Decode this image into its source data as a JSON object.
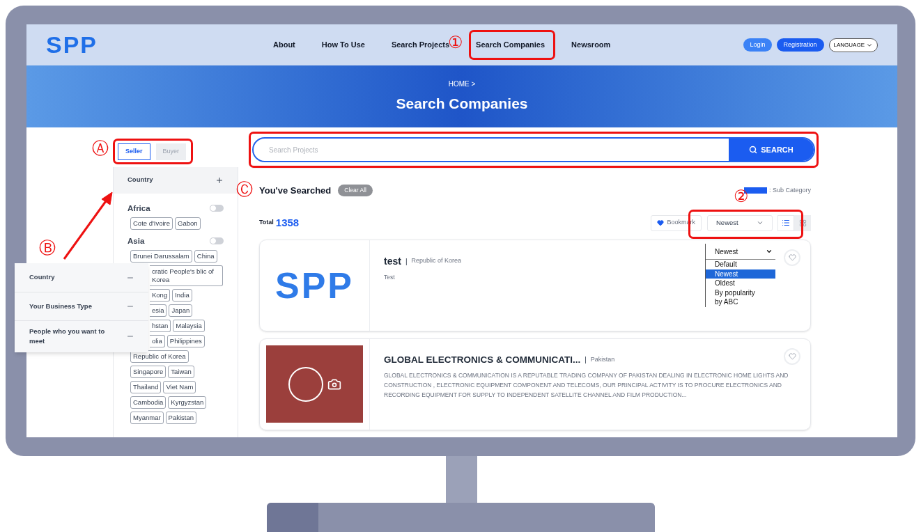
{
  "nav": {
    "logo": "SPP",
    "links": [
      {
        "label": "About"
      },
      {
        "label": "How To Use"
      },
      {
        "label": "Search Projects"
      },
      {
        "label": "Search Companies"
      },
      {
        "label": "Newsroom"
      }
    ],
    "login": "Login",
    "registration": "Registration",
    "language": "LANGUAGE"
  },
  "banner": {
    "breadcrumb": "HOME >",
    "title": "Search Companies"
  },
  "role_tabs": [
    {
      "label": "Seller",
      "selected": true
    },
    {
      "label": "Buyer",
      "selected": false
    }
  ],
  "filter": {
    "header": {
      "label": "Country",
      "expanded": false
    },
    "sections": [
      {
        "name": "Africa",
        "on": false,
        "rows": [
          [
            {
              "label": "Cote d'Ivoire",
              "kind": "full"
            },
            {
              "label": "Gabon",
              "kind": "full"
            }
          ]
        ]
      },
      {
        "name": "Asia",
        "on": false,
        "rows": [
          [
            {
              "label": "Brunei Darussalam",
              "kind": "full"
            },
            {
              "label": "China",
              "kind": "full"
            }
          ],
          [
            {
              "label": "cratic People's blic of Korea",
              "kind": "partial"
            }
          ],
          [
            {
              "label": "Kong",
              "kind": "partial"
            },
            {
              "label": "India",
              "kind": "full"
            }
          ],
          [
            {
              "label": "esia",
              "kind": "partial"
            },
            {
              "label": "Japan",
              "kind": "full"
            }
          ],
          [
            {
              "label": "hstan",
              "kind": "partial"
            },
            {
              "label": "Malaysia",
              "kind": "full"
            }
          ],
          [
            {
              "label": "olia",
              "kind": "partial"
            },
            {
              "label": "Philippines",
              "kind": "full"
            }
          ],
          [
            {
              "label": "Republic of Korea",
              "kind": "full"
            }
          ],
          [
            {
              "label": "Singapore",
              "kind": "full"
            },
            {
              "label": "Taiwan",
              "kind": "full"
            }
          ],
          [
            {
              "label": "Thailand",
              "kind": "full"
            },
            {
              "label": "Viet Nam",
              "kind": "full"
            }
          ],
          [
            {
              "label": "Cambodia",
              "kind": "full"
            },
            {
              "label": "Kyrgyzstan",
              "kind": "full"
            }
          ],
          [
            {
              "label": "Myanmar",
              "kind": "full"
            },
            {
              "label": "Pakistan",
              "kind": "full"
            }
          ]
        ]
      }
    ]
  },
  "filter_popout": [
    {
      "label": "Country",
      "expanded": true
    },
    {
      "label": "Your Business Type",
      "expanded": true
    },
    {
      "label": "People who you want to meet",
      "expanded": true
    }
  ],
  "search": {
    "placeholder": "Search Projects",
    "button": "SEARCH"
  },
  "searched": {
    "title": "You've Searched",
    "clear": "Clear All",
    "legend": ": Sub Category"
  },
  "total": {
    "label": "Total",
    "count": "1358"
  },
  "toolbar": {
    "bookmark": "Bookmark",
    "sort": "Newest",
    "views": [
      {
        "kind": "list",
        "selected": true
      },
      {
        "kind": "grid",
        "selected": false
      }
    ]
  },
  "sort_menu": {
    "value": "Newest",
    "options": [
      {
        "label": "Default",
        "selected": false
      },
      {
        "label": "Newest",
        "selected": true
      },
      {
        "label": "Oldest",
        "selected": false
      },
      {
        "label": "By popularity",
        "selected": false
      },
      {
        "label": "by ABC",
        "selected": false
      }
    ]
  },
  "companies": [
    {
      "kind": "text_logo",
      "logo_text": "SPP",
      "name": "test",
      "separator": "|",
      "country": "Republic of Korea",
      "description": "Test",
      "bookmarked": false
    },
    {
      "kind": "photo_logo",
      "separator": "|",
      "name": "GLOBAL ELECTRONICS & COMMUNICATI...",
      "country": "Pakistan",
      "description": "GLOBAL ELECTRONICS & COMMUNICATION IS A REPUTABLE TRADING COMPANY OF PAKISTAN DEALING IN ELECTRONIC HOME LIGHTS AND CONSTRUCTION , ELECTRONIC EQUIPMENT COMPONENT AND TELECOMS, OUR PRINCIPAL ACTIVITY IS TO PROCURE ELECTRONICS AND RECORDING EQUIPMENT FOR SUPPLY TO INDEPENDENT SATELLITE CHANNEL AND FILM PRODUCTION...",
      "bookmarked": false
    }
  ],
  "annotations": [
    {
      "mark": "①"
    },
    {
      "mark": "②"
    },
    {
      "mark": "Ⓐ"
    },
    {
      "mark": "Ⓑ"
    },
    {
      "mark": "Ⓒ"
    }
  ]
}
